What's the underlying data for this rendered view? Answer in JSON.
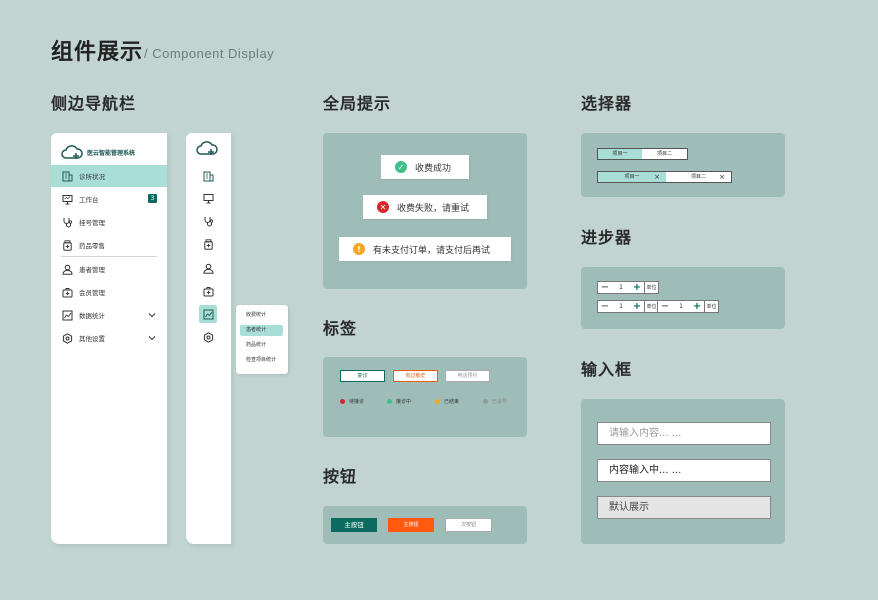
{
  "page": {
    "title": "组件展示",
    "subtitle": "/ Component  Display"
  },
  "sections": {
    "sidenav": "侧边导航栏",
    "toast": "全局提示",
    "tags": "标签",
    "buttons": "按钮",
    "selector": "选择器",
    "stepper": "进步器",
    "input": "输入框"
  },
  "sidebar": {
    "app_name": "医云智能管理系统",
    "items": [
      {
        "label": "诊所状况",
        "icon": "building-icon",
        "active": true
      },
      {
        "label": "工作台",
        "icon": "monitor-icon",
        "badge": "3"
      },
      {
        "label": "挂号管理",
        "icon": "stethoscope-icon"
      },
      {
        "label": "药品零售",
        "icon": "medicine-bottle-icon"
      },
      {
        "label": "患者管理",
        "icon": "user-icon"
      },
      {
        "label": "会员管理",
        "icon": "medkit-icon"
      },
      {
        "label": "数据统计",
        "icon": "chart-icon",
        "expandable": true
      },
      {
        "label": "其他设置",
        "icon": "gear-icon",
        "expandable": true
      }
    ]
  },
  "flyout": {
    "items": [
      "收费统计",
      "患者统计",
      "药品统计",
      "检查项目统计"
    ],
    "active_index": 1
  },
  "toasts": [
    {
      "text": "收费成功",
      "type": "success",
      "icon": "check-circle-icon",
      "color": "#3fbf8a"
    },
    {
      "text": "收费失败，请重试",
      "type": "error",
      "icon": "close-circle-icon",
      "color": "#d9262c"
    },
    {
      "text": "有未支付订单，请支付后再试",
      "type": "warning",
      "icon": "exclamation-circle-icon",
      "color": "#f5a623"
    }
  ],
  "tags": {
    "outlined": [
      {
        "text": "复诊",
        "color": "#0d6a60"
      },
      {
        "text": "有过敏史",
        "color": "#e85d11"
      },
      {
        "text": "电话预约",
        "color": "#aaaaaa"
      }
    ],
    "dotted": [
      {
        "text": "待接诊",
        "color": "#d9262c"
      },
      {
        "text": "接诊中",
        "color": "#3fbf8a"
      },
      {
        "text": "已结束",
        "color": "#f5a623"
      },
      {
        "text": "已退号",
        "color": "#999999"
      }
    ]
  },
  "buttons": {
    "primary": "主按钮",
    "accent": "主按钮",
    "secondary": "次按钮",
    "colors": {
      "primary": "#0d6a60",
      "accent": "#ff5a0f"
    }
  },
  "selector": {
    "row1": [
      "项目一",
      "项目二"
    ],
    "row2": [
      "项目一",
      "项目二"
    ],
    "close": "×"
  },
  "stepper": {
    "minus": "−",
    "plus": "+",
    "items": [
      {
        "value": "1",
        "unit": "单位"
      },
      {
        "value": "1",
        "unit": "单位"
      },
      {
        "value": "1",
        "unit": "单位"
      }
    ]
  },
  "inputs": {
    "placeholder": "请输入内容... ...",
    "filled": "内容输入中... ...",
    "disabled": "默认展示"
  },
  "colors": {
    "background": "#c1d4d2",
    "panel": "#9fbdb8",
    "primary": "#0d6a60",
    "highlight": "#a9ded7"
  }
}
